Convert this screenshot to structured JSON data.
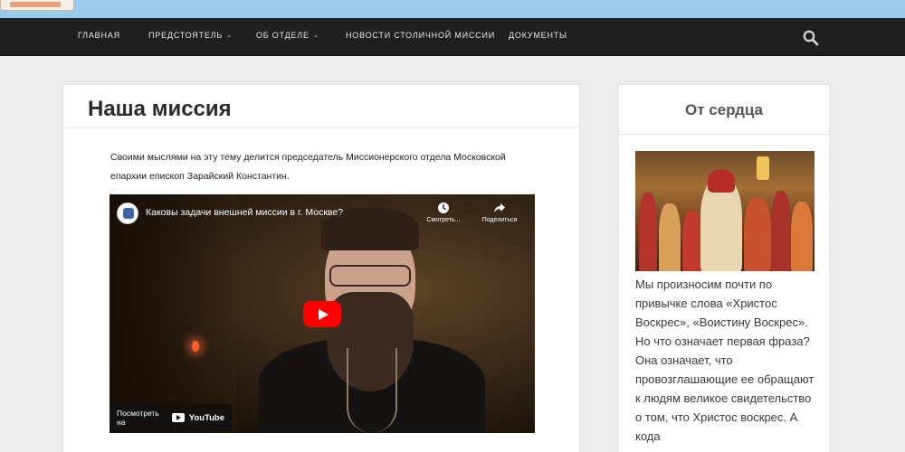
{
  "header": {
    "nav": [
      {
        "label": "ГЛАВНАЯ",
        "dropdown": false
      },
      {
        "label": "ПРЕДСТОЯТЕЛЬ",
        "dropdown": true
      },
      {
        "label": "ОБ ОТДЕЛЕ",
        "dropdown": true
      },
      {
        "label": "НОВОСТИ СТОЛИЧНОЙ МИССИИ",
        "dropdown": false
      },
      {
        "label": "ДОКУМЕНТЫ",
        "dropdown": false
      }
    ],
    "caret": "⌄",
    "search_icon": "search-icon"
  },
  "main": {
    "title": "Наша миссия",
    "intro": "Своими мыслями на эту тему делится председатель Миссионерского отдела Московской епархии епископ Зарайский Константин.",
    "video": {
      "title": "Каковы задачи внешней миссии в г. Москве?",
      "watch_later": "Смотреть...",
      "share": "Поделиться",
      "watch_on": "Посмотреть на",
      "youtube": "YouTube"
    }
  },
  "sidebar": {
    "title": "От сердца",
    "text": "Мы произносим почти по привычке слова «Христос Воскрес», «Воистину Воскрес». Но что означает первая фраза? Она означает, что провозглашающие ее обращают к людям великое свидетельство о том, что Христос воскрес. А кода"
  },
  "colors": {
    "topbar": "#9ccbea",
    "nav_bg": "#1f1f1f",
    "page_bg": "#ececec",
    "youtube_red": "#ff0000"
  }
}
